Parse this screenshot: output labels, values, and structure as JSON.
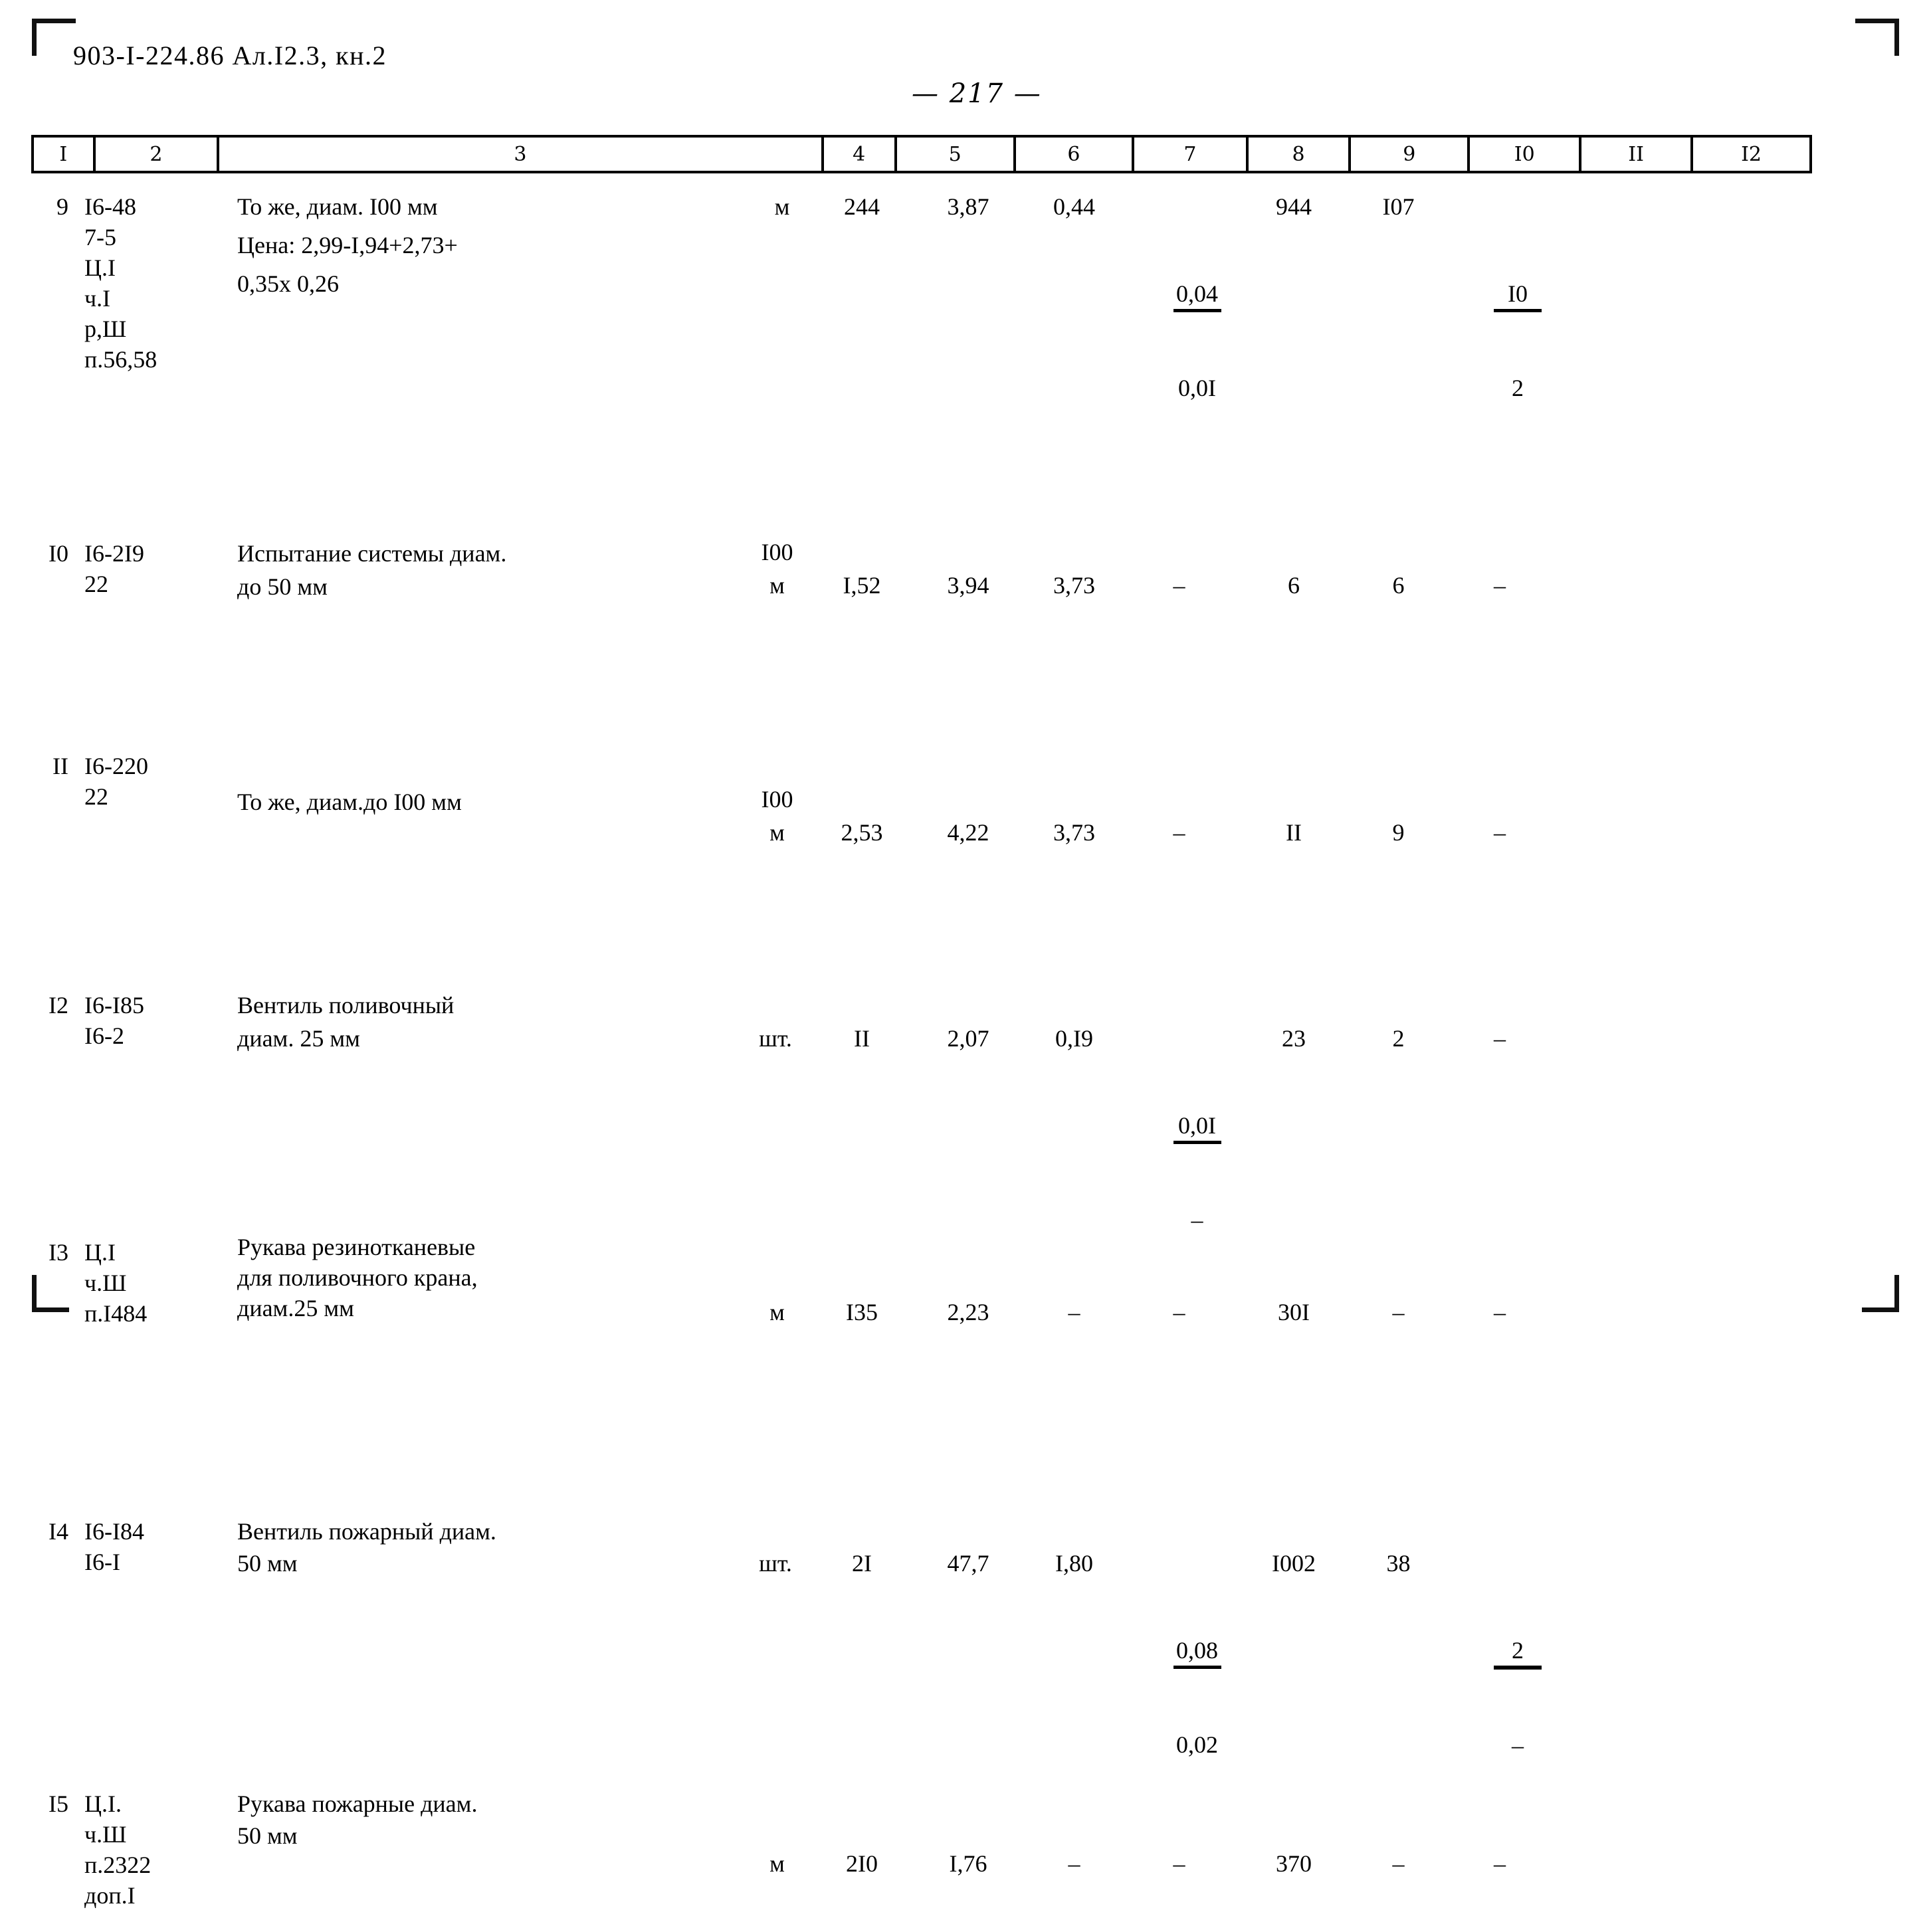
{
  "document": {
    "code": "903-I-224.86 Ал.I2.3, кн.2",
    "page_number": "— 217 —"
  },
  "table": {
    "column_headers": [
      "I",
      "2",
      "3",
      "4",
      "5",
      "6",
      "7",
      "8",
      "9",
      "I0",
      "II",
      "I2"
    ],
    "rows": [
      {
        "c1": "9",
        "c2": "I6-48\n7-5\nЦ.I\nч.I\nр,Ш\nп.56,58",
        "c3_line1": "То же, диам. I00 мм",
        "c3_line2": "Цена: 2,99-I,94+2,73+",
        "c3_line3": "0,35х 0,26",
        "c4": "м",
        "c4_sup": "",
        "c5": "244",
        "c6": "3,87",
        "c7": "0,44",
        "c8_top": "0,04",
        "c8_bot": "0,0I",
        "c9": "944",
        "c10": "I07",
        "c11_top": "I0",
        "c11_bot": "2",
        "c12": ""
      },
      {
        "c1": "I0",
        "c2": "I6-2I9\n22",
        "c3_line1": "Испытание системы диам.",
        "c3_line2": "до 50 мм",
        "c3_line3": "",
        "c4": "м",
        "c4_sup": "I00",
        "c5": "I,52",
        "c6": "3,94",
        "c7": "3,73",
        "c8_top": "–",
        "c8_bot": "",
        "c9": "6",
        "c10": "6",
        "c11_top": "–",
        "c11_bot": "",
        "c12": ""
      },
      {
        "c1": "II",
        "c2": "I6-220\n22",
        "c3_line1": "То же, диам.до I00 мм",
        "c3_line2": "",
        "c3_line3": "",
        "c4": "м",
        "c4_sup": "I00",
        "c5": "2,53",
        "c6": "4,22",
        "c7": "3,73",
        "c8_top": "–",
        "c8_bot": "",
        "c9": "II",
        "c10": "9",
        "c11_top": "–",
        "c11_bot": "",
        "c12": ""
      },
      {
        "c1": "I2",
        "c2": "I6-I85\nI6-2",
        "c3_line1": "Вентиль поливочный",
        "c3_line2": "диам. 25 мм",
        "c3_line3": "",
        "c4": "шт.",
        "c4_sup": "",
        "c5": "II",
        "c6": "2,07",
        "c7": "0,I9",
        "c8_top": "0,0I",
        "c8_bot": "–",
        "c9": "23",
        "c10": "2",
        "c11_top": "–",
        "c11_bot": "",
        "c12": ""
      },
      {
        "c1": "I3",
        "c2": "Ц.I\nч.Ш\nп.I484",
        "c3_line1": "Рукава резинотканевые",
        "c3_line2": "для поливочного крана,",
        "c3_line3": "диам.25 мм",
        "c4": "м",
        "c4_sup": "",
        "c5": "I35",
        "c6": "2,23",
        "c7": "–",
        "c8_top": "–",
        "c8_bot": "",
        "c9": "30I",
        "c10": "–",
        "c11_top": "–",
        "c11_bot": "",
        "c12": ""
      },
      {
        "c1": "I4",
        "c2": "I6-I84\nI6-I",
        "c3_line1": "Вентиль пожарный диам.",
        "c3_line2": "50 мм",
        "c3_line3": "",
        "c4": "шт.",
        "c4_sup": "",
        "c5": "2I",
        "c6": "47,7",
        "c7": "I,80",
        "c8_top": "0,08",
        "c8_bot": "0,02",
        "c9": "I002",
        "c10": "38",
        "c11_top": "2",
        "c11_bot": "–",
        "c12": ""
      },
      {
        "c1": "I5",
        "c2": "Ц.I.\nч.Ш\nп.2322\nдоп.I",
        "c3_line1": "Рукава пожарные диам.",
        "c3_line2": "50 мм",
        "c3_line3": "",
        "c4": "м",
        "c4_sup": "",
        "c5": "2I0",
        "c6": "I,76",
        "c7": "–",
        "c8_top": "–",
        "c8_bot": "",
        "c9": "370",
        "c10": "–",
        "c11_top": "–",
        "c11_bot": "",
        "c12": ""
      }
    ]
  }
}
